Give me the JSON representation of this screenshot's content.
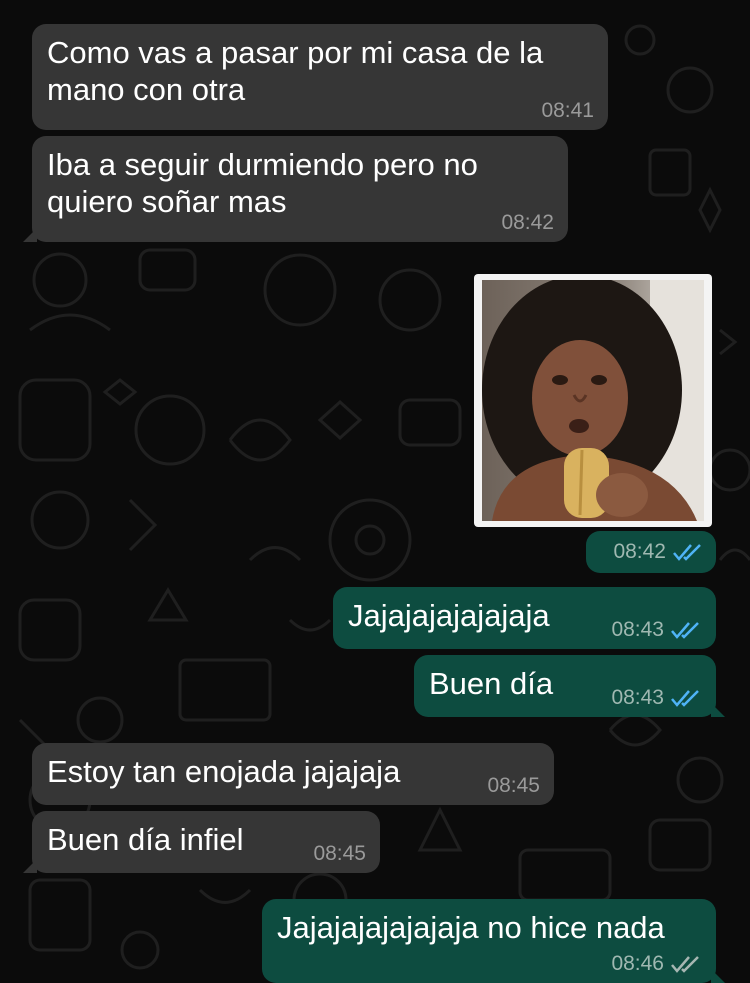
{
  "colors": {
    "incoming_bubble": "#363636",
    "outgoing_bubble": "#0d4c40",
    "read_ticks": "#4fb3f6",
    "delivered_ticks": "#a6b6b2"
  },
  "messages": [
    {
      "direction": "in",
      "text": "Como vas a pasar por mi casa de la mano con otra",
      "time": "08:41"
    },
    {
      "direction": "in",
      "text": "Iba a seguir durmiendo pero no quiero soñar mas",
      "time": "08:42"
    },
    {
      "direction": "out",
      "type": "image",
      "time": "08:42",
      "status": "read",
      "status_icon": "double-check-icon"
    },
    {
      "direction": "out",
      "text": "Jajajajajajajaja",
      "time": "08:43",
      "status": "read",
      "status_icon": "double-check-icon"
    },
    {
      "direction": "out",
      "text": "Buen día",
      "time": "08:43",
      "status": "read",
      "status_icon": "double-check-icon"
    },
    {
      "direction": "in",
      "text": "Estoy tan enojada jajajaja",
      "time": "08:45"
    },
    {
      "direction": "in",
      "text": "Buen día infiel",
      "time": "08:45"
    },
    {
      "direction": "out",
      "text": "Jajajajajajajaja no hice nada",
      "time": "08:46",
      "status": "delivered",
      "status_icon": "double-check-icon"
    }
  ]
}
